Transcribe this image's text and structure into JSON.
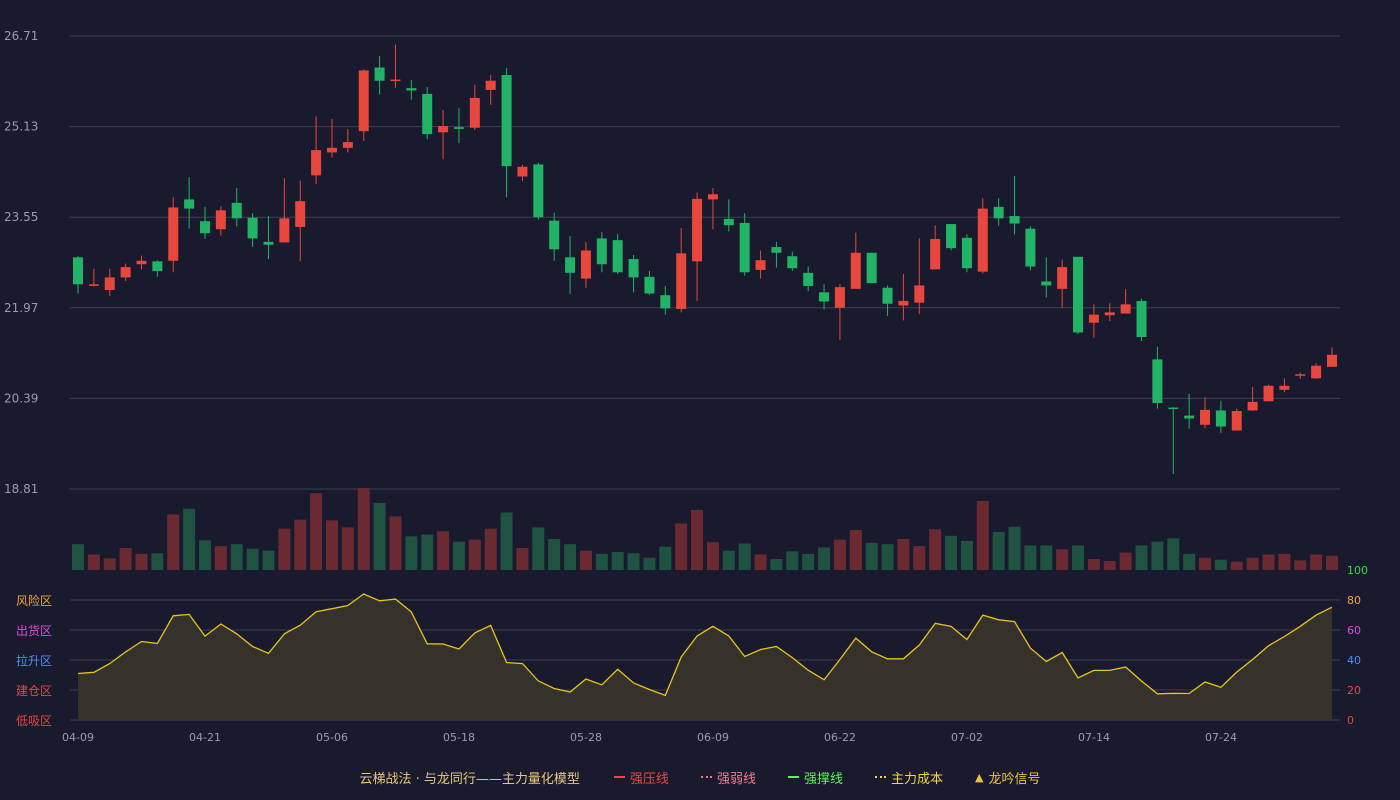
{
  "colors": {
    "background": "#191a2e",
    "up": "#e8473d",
    "down": "#21b466",
    "up_volume": "#6b2a32",
    "down_volume": "#1f5240",
    "indicator_line": "#e8c419",
    "indicator_fill": "#35322c",
    "grid": "#3c3e52",
    "axis_text": "#9a9cac"
  },
  "chart_data": [
    {
      "type": "candlestick",
      "ylim": [
        18.81,
        26.71
      ],
      "y_ticks": [
        "26.71",
        "25.13",
        "23.55",
        "21.97",
        "20.39",
        "18.81"
      ],
      "grid": true,
      "candles": [
        [
          22.85,
          22.38,
          22.87,
          22.22
        ],
        [
          22.38,
          22.38,
          22.65,
          22.34
        ],
        [
          22.28,
          22.5,
          22.65,
          22.18
        ],
        [
          22.5,
          22.68,
          22.74,
          22.44
        ],
        [
          22.73,
          22.79,
          22.88,
          22.64
        ],
        [
          22.78,
          22.61,
          22.8,
          22.51
        ],
        [
          22.79,
          23.72,
          23.9,
          22.59
        ],
        [
          23.86,
          23.7,
          24.25,
          23.35
        ],
        [
          23.48,
          23.27,
          23.73,
          23.17
        ],
        [
          23.34,
          23.67,
          23.74,
          23.23
        ],
        [
          23.8,
          23.53,
          24.06,
          23.39
        ],
        [
          23.54,
          23.18,
          23.62,
          23.03
        ],
        [
          23.12,
          23.07,
          23.57,
          22.82
        ],
        [
          23.11,
          23.53,
          24.23,
          23.11
        ],
        [
          23.38,
          23.83,
          24.19,
          22.78
        ],
        [
          24.28,
          24.72,
          25.31,
          24.13
        ],
        [
          24.68,
          24.76,
          25.26,
          24.59
        ],
        [
          24.76,
          24.86,
          25.09,
          24.68
        ],
        [
          25.05,
          26.11,
          26.13,
          24.88
        ],
        [
          26.16,
          25.93,
          26.36,
          25.69
        ],
        [
          25.94,
          25.95,
          26.56,
          25.8
        ],
        [
          25.8,
          25.76,
          25.94,
          25.6
        ],
        [
          25.7,
          25.0,
          25.82,
          24.91
        ],
        [
          25.03,
          25.14,
          25.42,
          24.56
        ],
        [
          25.12,
          25.09,
          25.45,
          24.84
        ],
        [
          25.11,
          25.63,
          25.86,
          25.07
        ],
        [
          25.77,
          25.93,
          26.03,
          25.51
        ],
        [
          26.03,
          24.44,
          26.15,
          23.9
        ],
        [
          24.26,
          24.43,
          24.46,
          24.18
        ],
        [
          24.47,
          23.55,
          24.5,
          23.51
        ],
        [
          23.49,
          22.99,
          23.63,
          22.79
        ],
        [
          22.85,
          22.58,
          23.22,
          22.21
        ],
        [
          22.48,
          22.97,
          23.12,
          22.32
        ],
        [
          23.18,
          22.73,
          23.29,
          22.59
        ],
        [
          23.15,
          22.59,
          23.26,
          22.56
        ],
        [
          22.82,
          22.5,
          22.89,
          22.24
        ],
        [
          22.51,
          22.22,
          22.61,
          22.19
        ],
        [
          22.19,
          21.96,
          22.35,
          21.85
        ],
        [
          21.95,
          22.92,
          23.36,
          21.89
        ],
        [
          22.78,
          23.87,
          23.98,
          22.09
        ],
        [
          23.86,
          23.95,
          24.06,
          23.34
        ],
        [
          23.52,
          23.41,
          23.86,
          23.3
        ],
        [
          23.45,
          22.59,
          23.62,
          22.53
        ],
        [
          22.63,
          22.8,
          22.97,
          22.48
        ],
        [
          23.03,
          22.93,
          23.12,
          22.67
        ],
        [
          22.87,
          22.66,
          22.95,
          22.61
        ],
        [
          22.58,
          22.35,
          22.69,
          22.26
        ],
        [
          22.24,
          22.08,
          22.38,
          21.94
        ],
        [
          21.97,
          22.33,
          22.38,
          21.41
        ],
        [
          22.3,
          22.93,
          23.28,
          22.3
        ],
        [
          22.93,
          22.4,
          22.92,
          22.4
        ],
        [
          22.32,
          22.04,
          22.36,
          21.83
        ],
        [
          22.01,
          22.09,
          22.56,
          21.75
        ],
        [
          22.06,
          22.36,
          23.18,
          21.86
        ],
        [
          22.64,
          23.17,
          23.41,
          22.64
        ],
        [
          23.43,
          23.01,
          23.43,
          22.97
        ],
        [
          23.19,
          22.66,
          23.25,
          22.59
        ],
        [
          22.6,
          23.7,
          23.88,
          22.57
        ],
        [
          23.73,
          23.53,
          23.88,
          23.4
        ],
        [
          23.57,
          23.44,
          24.27,
          23.25
        ],
        [
          23.35,
          22.69,
          23.39,
          22.62
        ],
        [
          22.43,
          22.36,
          22.85,
          22.15
        ],
        [
          22.3,
          22.68,
          22.81,
          21.97
        ],
        [
          22.86,
          21.54,
          22.81,
          21.51
        ],
        [
          21.71,
          21.85,
          22.03,
          21.45
        ],
        [
          21.84,
          21.89,
          22.05,
          21.74
        ],
        [
          21.87,
          22.03,
          22.3,
          21.89
        ],
        [
          22.09,
          21.46,
          22.13,
          21.39
        ],
        [
          21.07,
          20.31,
          21.29,
          20.21
        ],
        [
          20.23,
          20.21,
          20.24,
          19.07
        ],
        [
          20.09,
          20.04,
          20.47,
          19.86
        ],
        [
          19.93,
          20.19,
          20.41,
          19.87
        ],
        [
          20.18,
          19.9,
          20.35,
          19.79
        ],
        [
          19.83,
          20.17,
          20.21,
          19.89
        ],
        [
          20.18,
          20.33,
          20.59,
          20.17
        ],
        [
          20.34,
          20.61,
          20.63,
          20.42
        ],
        [
          20.54,
          20.61,
          20.74,
          20.5
        ],
        [
          20.79,
          20.81,
          20.84,
          20.73
        ],
        [
          20.74,
          20.96,
          21.0,
          20.73
        ],
        [
          20.94,
          21.15,
          21.28,
          20.97
        ]
      ],
      "volume": [
        0.4,
        0.24,
        0.18,
        0.34,
        0.25,
        0.26,
        0.86,
        0.95,
        0.46,
        0.37,
        0.4,
        0.33,
        0.3,
        0.64,
        0.78,
        1.19,
        0.77,
        0.66,
        1.27,
        1.04,
        0.83,
        0.52,
        0.55,
        0.6,
        0.44,
        0.47,
        0.64,
        0.89,
        0.34,
        0.66,
        0.48,
        0.4,
        0.3,
        0.25,
        0.28,
        0.26,
        0.19,
        0.36,
        0.72,
        0.93,
        0.43,
        0.3,
        0.41,
        0.24,
        0.17,
        0.29,
        0.25,
        0.35,
        0.47,
        0.62,
        0.42,
        0.4,
        0.48,
        0.37,
        0.63,
        0.53,
        0.45,
        1.07,
        0.59,
        0.67,
        0.38,
        0.38,
        0.32,
        0.38,
        0.17,
        0.14,
        0.27,
        0.38,
        0.44,
        0.49,
        0.25,
        0.19,
        0.16,
        0.13,
        0.19,
        0.24,
        0.25,
        0.15,
        0.24,
        0.22
      ]
    },
    {
      "type": "area",
      "ylim": [
        0,
        100
      ],
      "y_ticks": [
        "100",
        "80",
        "60",
        "40",
        "20",
        "0"
      ],
      "zone_labels": [
        "风险区",
        "出货区",
        "拉升区",
        "建仓区",
        "低吸区"
      ],
      "zone_label_colors": [
        "#f2a33c",
        "#e04be0",
        "#4b8ef5",
        "#e8473d",
        "#e8473d"
      ],
      "right_tick_colors": [
        "#3ddc3d",
        "#f2a33c",
        "#e04be0",
        "#4b8ef5",
        "#e8473d",
        "#e8473d"
      ],
      "x_labels": [
        "04-09",
        "04-21",
        "05-06",
        "05-18",
        "05-28",
        "06-09",
        "06-22",
        "07-02",
        "07-14",
        "07-24"
      ],
      "values": [
        31.0,
        31.8,
        37.6,
        45.4,
        52.3,
        51.1,
        69.5,
        70.4,
        55.9,
        64.0,
        57.5,
        49.0,
        44.5,
        57.5,
        63.2,
        72.2,
        74.2,
        76.3,
        84.0,
        79.5,
        80.6,
        72.1,
        50.8,
        50.7,
        47.3,
        58.1,
        63.1,
        38.3,
        37.6,
        26.1,
        21.0,
        18.7,
        27.3,
        23.5,
        33.8,
        24.7,
        20.3,
        16.4,
        42.0,
        56.0,
        62.5,
        56.0,
        42.3,
        47.0,
        49.0,
        41.6,
        33.2,
        26.8,
        40.3,
        54.6,
        45.5,
        40.8,
        40.8,
        50.0,
        64.4,
        62.5,
        53.7,
        69.9,
        66.8,
        65.6,
        47.9,
        39.0,
        45.0,
        28.1,
        33.1,
        33.1,
        35.3,
        26.0,
        17.5,
        17.8,
        17.7,
        25.3,
        21.8,
        32.0,
        40.3,
        49.5,
        55.7,
        62.5,
        69.9,
        75.2
      ]
    }
  ],
  "legend": {
    "title": "云梯战法 · 与龙同行——主力量化模型",
    "items": [
      {
        "label": "强压线",
        "color": "#ef4444",
        "style": "solid"
      },
      {
        "label": "强弱线",
        "color": "#f27a8c",
        "style": "dotted"
      },
      {
        "label": "强撑线",
        "color": "#5df25d",
        "style": "solid"
      },
      {
        "label": "主力成本",
        "color": "#f2d63c",
        "style": "dotted"
      },
      {
        "label": "龙吟信号",
        "color": "#f2c23c",
        "style": "triangle"
      }
    ]
  }
}
